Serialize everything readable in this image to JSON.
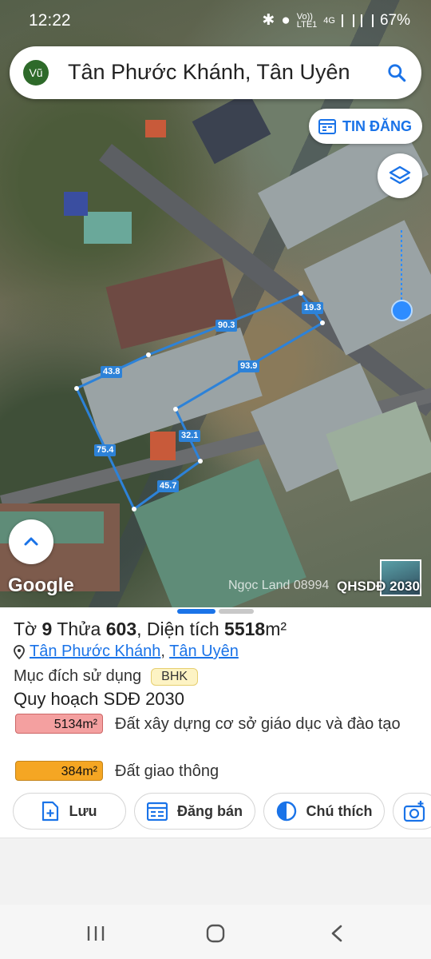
{
  "status": {
    "time": "12:22",
    "network_vo": "Vo))",
    "network_lte": "LTE1",
    "network_4g": "4G",
    "battery": "67%"
  },
  "search": {
    "avatar_text": "Vũ",
    "query": "Tân Phước Khánh, Tân Uyên"
  },
  "map": {
    "tin_dang_label": "TIN ĐĂNG",
    "google_label": "Google",
    "watermark": "Ngọc Land  08994",
    "overlay_label": "QHSDĐ 2030",
    "dimensions": [
      "90.3",
      "19.3",
      "43.8",
      "93.9",
      "32.1",
      "75.4",
      "45.7"
    ],
    "location_color": "#2d8cff",
    "boundary_color": "#2d82d8"
  },
  "parcel": {
    "to_prefix": "Tờ ",
    "to_value": "9",
    "thua_prefix": " Thửa ",
    "thua_value": "603",
    "dien_tich_prefix": ", Diện tích ",
    "dien_tich_value": "5518",
    "unit": "m²",
    "ward": "Tân Phước Khánh",
    "separator": ", ",
    "district": "Tân Uyên",
    "muc_dich_label": "Mục đích sử dụng",
    "muc_dich_code": "BHK",
    "quy_hoach_label": "Quy hoạch SDĐ 2030",
    "areas": [
      {
        "value": "5134m²",
        "label": "Đất xây dựng cơ sở giáo dục và đào tạo",
        "color": "#f4a0a0"
      },
      {
        "value": "384m²",
        "label": "Đất giao thông",
        "color": "#f5a623"
      }
    ]
  },
  "actions": {
    "luu": "Lưu",
    "dang_ban": "Đăng bán",
    "chu_thich": "Chú thích"
  },
  "colors": {
    "accent": "#1a73e8"
  }
}
